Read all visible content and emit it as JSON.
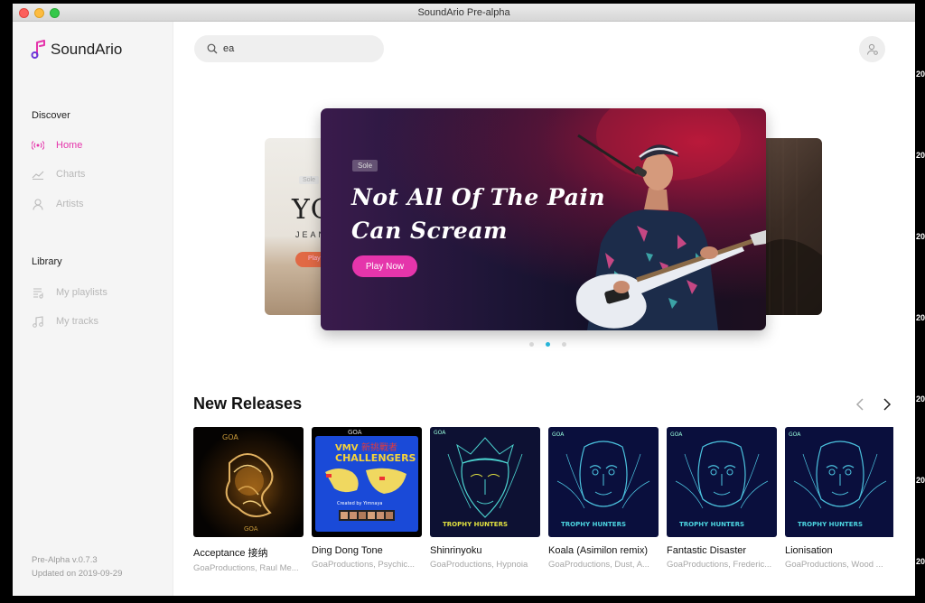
{
  "window": {
    "title": "SoundArio Pre-alpha"
  },
  "app": {
    "name": "SoundArio",
    "version": "Pre-Alpha v.0.7.3",
    "updated": "Updated on 2019-09-29"
  },
  "sidebar": {
    "discover_heading": "Discover",
    "discover_items": [
      {
        "label": "Home",
        "icon": "broadcast-icon",
        "active": true
      },
      {
        "label": "Charts",
        "icon": "chart-icon",
        "active": false
      },
      {
        "label": "Artists",
        "icon": "person-icon",
        "active": false
      }
    ],
    "library_heading": "Library",
    "library_items": [
      {
        "label": "My playlists",
        "icon": "playlist-icon"
      },
      {
        "label": "My tracks",
        "icon": "music-note-icon"
      }
    ]
  },
  "search": {
    "value": "ea"
  },
  "banner": {
    "tag": "Sole",
    "title_line1": "Not All Of The Pain",
    "title_line2": "Can Scream",
    "button": "Play Now",
    "side_left": {
      "tag": "Sole",
      "text": "YO",
      "subtext": "JEAN",
      "button": "Play"
    },
    "dots": 3,
    "active_dot": 1
  },
  "new_releases": {
    "title": "New Releases",
    "albums": [
      {
        "title": "Acceptance 接纳",
        "artists": "GoaProductions, Raul Me..."
      },
      {
        "title": "Ding Dong Tone",
        "artists": "GoaProductions, Psychic..."
      },
      {
        "title": "Shinrinyoku",
        "artists": "GoaProductions, Hypnoia"
      },
      {
        "title": "Koala (Asimilon remix)",
        "artists": "GoaProductions, Dust, A..."
      },
      {
        "title": "Fantastic Disaster",
        "artists": "GoaProductions, Frederic..."
      },
      {
        "title": "Lionisation",
        "artists": "GoaProductions, Wood ..."
      }
    ],
    "cover_texts": {
      "label": "GOA",
      "challengers_1": "VMV",
      "challengers_2": "新挑戰者",
      "challengers_3": "CHALLENGERS",
      "challengers_4": "Created by Yimnaya",
      "trophy": "TROPHY HUNTERS"
    }
  },
  "colors": {
    "accent": "#e535ab",
    "dot_active": "#27b4d8"
  },
  "edge_numbers": [
    "20",
    "20",
    "20",
    "20",
    "20",
    "20",
    "20"
  ]
}
